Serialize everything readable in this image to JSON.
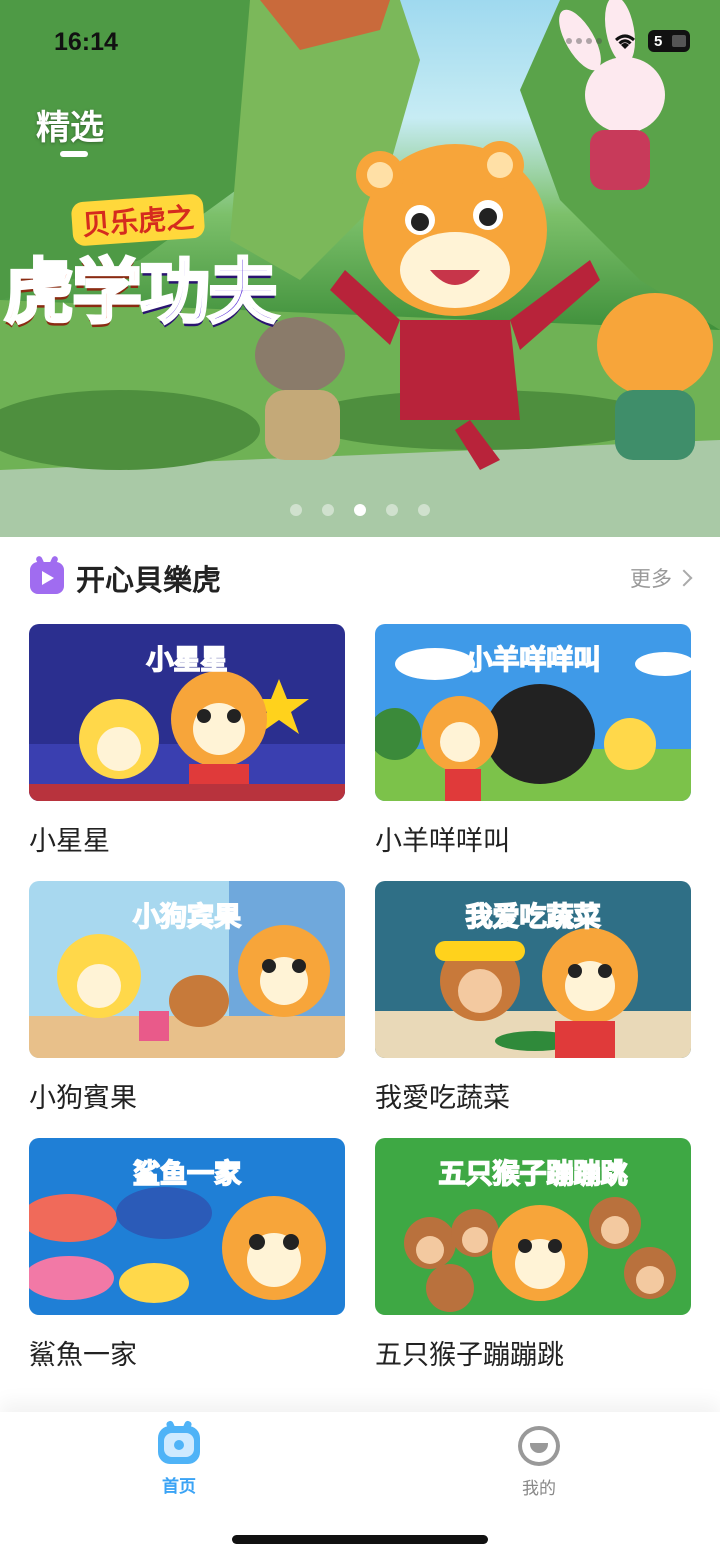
{
  "status_bar": {
    "time": "16:14",
    "battery": "5"
  },
  "header": {
    "tab": "精选"
  },
  "banner": {
    "logo_small": "贝乐虎之",
    "title_part1": "虎学",
    "title_part2": "功夫",
    "slides": 5,
    "active_slide": 3
  },
  "section": {
    "title": "开心貝樂虎",
    "more": "更多"
  },
  "cards": [
    {
      "label": "小星星",
      "thumb_title": "小星星"
    },
    {
      "label": "小羊咩咩叫",
      "thumb_title": "小羊咩咩叫"
    },
    {
      "label": "小狗賓果",
      "thumb_title": "小狗宾果"
    },
    {
      "label": "我愛吃蔬菜",
      "thumb_title": "我爱吃蔬菜"
    },
    {
      "label": "鯊魚一家",
      "thumb_title": "鲨鱼一家"
    },
    {
      "label": "五只猴子蹦蹦跳",
      "thumb_title": "五只猴子蹦蹦跳"
    }
  ],
  "tab_bar": {
    "home": "首页",
    "me": "我的"
  },
  "colors": {
    "accent": "#3aa3f5",
    "section_icon": "#a06cf0",
    "text": "#222222",
    "muted": "#999999"
  }
}
